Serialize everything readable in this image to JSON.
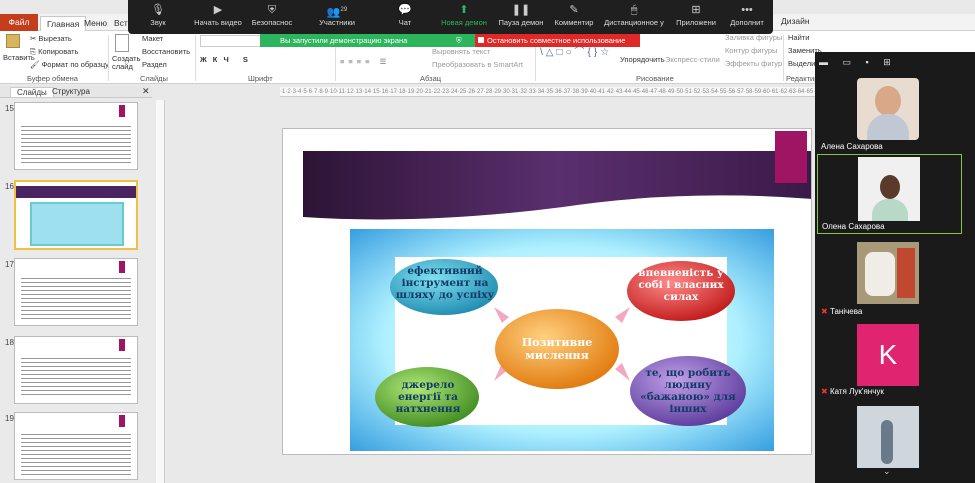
{
  "ribbon_tabs": [
    "Файл",
    "Главная",
    "Меню",
    "Вставка",
    "Дизайн"
  ],
  "zoom": {
    "buttons": [
      {
        "label": "Звук",
        "icon": "microphone-icon"
      },
      {
        "label": "Начать видео",
        "icon": "camera-icon"
      },
      {
        "label": "Безопаснос",
        "icon": "shield-icon"
      },
      {
        "label": "Участники",
        "icon": "participants-icon",
        "count": "29"
      },
      {
        "label": "Чат",
        "icon": "chat-icon"
      },
      {
        "label": "Новая демон",
        "icon": "share-screen-icon"
      },
      {
        "label": "Пауза демон",
        "icon": "pause-icon"
      },
      {
        "label": "Комментир",
        "icon": "annotate-icon"
      },
      {
        "label": "Дистанционное у",
        "icon": "remote-control-icon"
      },
      {
        "label": "Приложени",
        "icon": "apps-icon"
      },
      {
        "label": "Дополнит",
        "icon": "more-icon"
      }
    ],
    "share_notice": "Вы запустили демонстрацию экрана",
    "stop_share": "Остановить совместное использование"
  },
  "ribbon": {
    "paste": "Вставить",
    "cut": "Вырезать",
    "copy": "Копировать",
    "format_painter": "Формат по образцу",
    "clipboard_group": "Буфер обмена",
    "create_slide": "Создать слайд",
    "layout": "Макет",
    "reset": "Восстановить",
    "section": "Раздел",
    "slides_group": "Слайды",
    "font_group": "Шрифт",
    "paragraph_group": "Абзац",
    "align_text": "Выровнять текст",
    "smartart": "Преобразовать в SmartArt",
    "arrange": "Упорядочить",
    "quick_styles": "Экспресс-стили",
    "shape_fill": "Заливка фигуры",
    "shape_outline": "Контур фигуры",
    "shape_effects": "Эффекты фигур",
    "drawing_group": "Рисование",
    "find": "Найти",
    "replace": "Заменить",
    "select": "Выделить",
    "editing_group": "Редактир"
  },
  "panel_tabs": [
    "Слайды",
    "Структура"
  ],
  "thumbnails": [
    "15",
    "16",
    "17",
    "18",
    "19"
  ],
  "slide": {
    "center": "Позитивне мислення",
    "top_left": "ефективний інструмент на шляху до успіху",
    "top_right": "впевненість у собі і власних силах",
    "bottom_left": "джерело енергії та натхнення",
    "bottom_right": "те, що робить людину «бажаною» для інших"
  },
  "participants": [
    {
      "name": "Алена Сахарова",
      "kind": "photo"
    },
    {
      "name": "Олена Сахарова",
      "kind": "photo",
      "active": true
    },
    {
      "name": "Танічева",
      "kind": "photo",
      "muted": true
    },
    {
      "name": "Катя Лук'янчук",
      "kind": "avatar",
      "initial": "K",
      "color": "#e0246f",
      "muted": true
    },
    {
      "name": "",
      "kind": "photo"
    }
  ]
}
